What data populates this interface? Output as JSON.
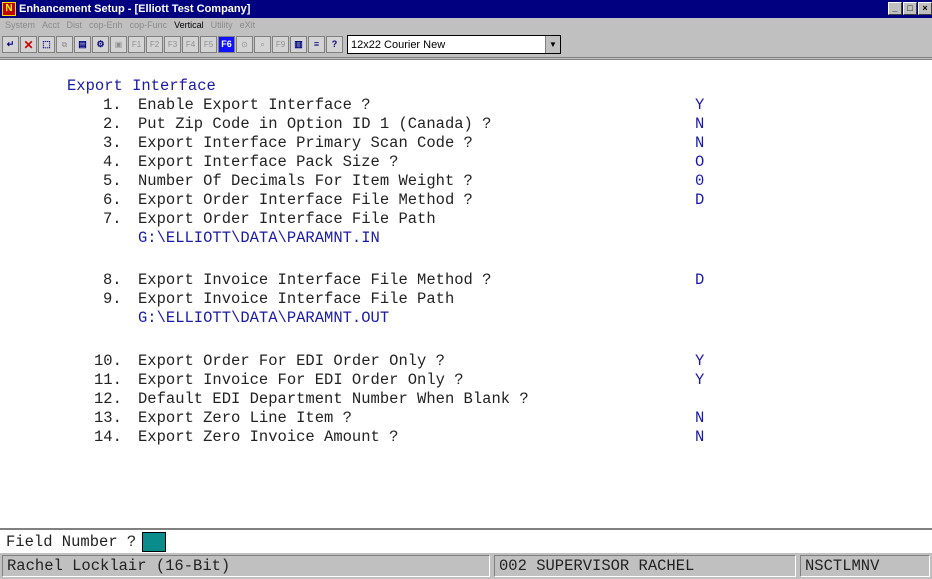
{
  "window": {
    "title": "Enhancement Setup - [Elliott Test Company]",
    "app_icon_letter": "N",
    "icons": [
      "minimize-icon",
      "maximize-icon",
      "close-icon"
    ]
  },
  "menu": [
    "System",
    "Acct",
    "Dist",
    "cop-Enh",
    "cop-Func",
    "Vertical",
    "Utility",
    "eXit"
  ],
  "toolbar": {
    "font_selector": "12x22 Courier New"
  },
  "screen": {
    "heading": "Export Interface",
    "fields": [
      {
        "num": "1.",
        "label": "Enable Export Interface ?",
        "value": "Y"
      },
      {
        "num": "2.",
        "label": "Put Zip Code in Option ID 1 (Canada) ?",
        "value": "N"
      },
      {
        "num": "3.",
        "label": "Export Interface Primary Scan Code ?",
        "value": "N"
      },
      {
        "num": "4.",
        "label": "Export Interface Pack Size ?",
        "value": "O"
      },
      {
        "num": "5.",
        "label": "Number Of Decimals For Item Weight ?",
        "value": "0"
      },
      {
        "num": "6.",
        "label": "Export Order Interface File Method ?",
        "value": "D"
      },
      {
        "num": "7.",
        "label": "Export Order Interface File Path",
        "value": "",
        "path": "G:\\ELLIOTT\\DATA\\PARAMNT.IN"
      },
      {
        "num": "8.",
        "label": "Export Invoice Interface File Method ?",
        "value": "D"
      },
      {
        "num": "9.",
        "label": "Export Invoice Interface File Path",
        "value": "",
        "path": "G:\\ELLIOTT\\DATA\\PARAMNT.OUT"
      },
      {
        "num": "10.",
        "label": "Export Order For EDI Order Only ?",
        "value": "Y"
      },
      {
        "num": "11.",
        "label": "Export Invoice For EDI Order Only ?",
        "value": "Y"
      },
      {
        "num": "12.",
        "label": "Default EDI Department Number When Blank ?",
        "value": ""
      },
      {
        "num": "13.",
        "label": "Export Zero Line Item ?",
        "value": "N"
      },
      {
        "num": "14.",
        "label": "Export Zero Invoice Amount ?",
        "value": "N"
      }
    ]
  },
  "prompt": {
    "label": "Field Number ?",
    "value": ""
  },
  "status": {
    "user": "Rachel Locklair (16-Bit)",
    "session": "002 SUPERVISOR RACHEL",
    "program": "NSCTLMNV"
  },
  "colors": {
    "title_bar": "#000080",
    "screen_text_blue": "#1a1aa8",
    "prompt_input": "#0a8c8c"
  }
}
